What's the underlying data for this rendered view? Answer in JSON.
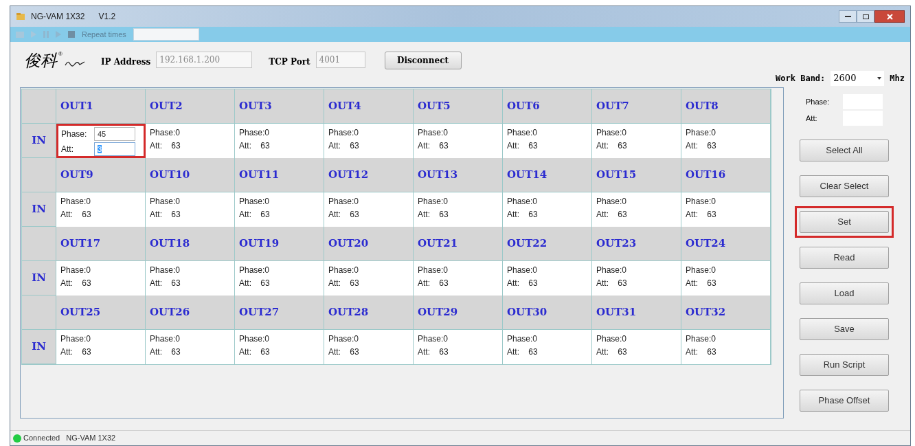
{
  "window": {
    "title": "NG-VAM 1X32",
    "version": "V1.2"
  },
  "toolbar": {
    "repeat_label": "Repeat times"
  },
  "logo": {
    "text": "俊科",
    "mark": "®"
  },
  "connection": {
    "ip_label": "IP Address",
    "ip_value": "192.168.1.200",
    "port_label": "TCP Port",
    "port_value": "4001",
    "button": "Disconnect"
  },
  "work_band": {
    "label": "Work Band:",
    "value": "2600",
    "unit": "Mhz"
  },
  "groups": [
    {
      "in_label": "IN",
      "outputs": [
        {
          "label": "OUT1",
          "kind": "input",
          "phase_label": "Phase:",
          "phase": "45",
          "att_label": "Att:",
          "att": "3",
          "att_selected": true,
          "highlighted": true
        },
        {
          "label": "OUT2",
          "kind": "text",
          "phase_label": "Phase:",
          "phase": "0",
          "att_label": "Att:",
          "att": "63",
          "highlighted": false
        },
        {
          "label": "OUT3",
          "kind": "text",
          "phase_label": "Phase:",
          "phase": "0",
          "att_label": "Att:",
          "att": "63",
          "highlighted": false
        },
        {
          "label": "OUT4",
          "kind": "text",
          "phase_label": "Phase:",
          "phase": "0",
          "att_label": "Att:",
          "att": "63",
          "highlighted": false
        },
        {
          "label": "OUT5",
          "kind": "text",
          "phase_label": "Phase:",
          "phase": "0",
          "att_label": "Att:",
          "att": "63",
          "highlighted": false
        },
        {
          "label": "OUT6",
          "kind": "text",
          "phase_label": "Phase:",
          "phase": "0",
          "att_label": "Att:",
          "att": "63",
          "highlighted": false
        },
        {
          "label": "OUT7",
          "kind": "text",
          "phase_label": "Phase:",
          "phase": "0",
          "att_label": "Att:",
          "att": "63",
          "highlighted": false
        },
        {
          "label": "OUT8",
          "kind": "text",
          "phase_label": "Phase:",
          "phase": "0",
          "att_label": "Att:",
          "att": "63",
          "highlighted": false
        }
      ]
    },
    {
      "in_label": "IN",
      "outputs": [
        {
          "label": "OUT9",
          "kind": "text",
          "phase_label": "Phase:",
          "phase": "0",
          "att_label": "Att:",
          "att": "63",
          "highlighted": false
        },
        {
          "label": "OUT10",
          "kind": "text",
          "phase_label": "Phase:",
          "phase": "0",
          "att_label": "Att:",
          "att": "63",
          "highlighted": false
        },
        {
          "label": "OUT11",
          "kind": "text",
          "phase_label": "Phase:",
          "phase": "0",
          "att_label": "Att:",
          "att": "63",
          "highlighted": false
        },
        {
          "label": "OUT12",
          "kind": "text",
          "phase_label": "Phase:",
          "phase": "0",
          "att_label": "Att:",
          "att": "63",
          "highlighted": false
        },
        {
          "label": "OUT13",
          "kind": "text",
          "phase_label": "Phase:",
          "phase": "0",
          "att_label": "Att:",
          "att": "63",
          "highlighted": false
        },
        {
          "label": "OUT14",
          "kind": "text",
          "phase_label": "Phase:",
          "phase": "0",
          "att_label": "Att:",
          "att": "63",
          "highlighted": false
        },
        {
          "label": "OUT15",
          "kind": "text",
          "phase_label": "Phase:",
          "phase": "0",
          "att_label": "Att:",
          "att": "63",
          "highlighted": false
        },
        {
          "label": "OUT16",
          "kind": "text",
          "phase_label": "Phase:",
          "phase": "0",
          "att_label": "Att:",
          "att": "63",
          "highlighted": false
        }
      ]
    },
    {
      "in_label": "IN",
      "outputs": [
        {
          "label": "OUT17",
          "kind": "text",
          "phase_label": "Phase:",
          "phase": "0",
          "att_label": "Att:",
          "att": "63",
          "highlighted": false
        },
        {
          "label": "OUT18",
          "kind": "text",
          "phase_label": "Phase:",
          "phase": "0",
          "att_label": "Att:",
          "att": "63",
          "highlighted": false
        },
        {
          "label": "OUT19",
          "kind": "text",
          "phase_label": "Phase:",
          "phase": "0",
          "att_label": "Att:",
          "att": "63",
          "highlighted": false
        },
        {
          "label": "OUT20",
          "kind": "text",
          "phase_label": "Phase:",
          "phase": "0",
          "att_label": "Att:",
          "att": "63",
          "highlighted": false
        },
        {
          "label": "OUT21",
          "kind": "text",
          "phase_label": "Phase:",
          "phase": "0",
          "att_label": "Att:",
          "att": "63",
          "highlighted": false
        },
        {
          "label": "OUT22",
          "kind": "text",
          "phase_label": "Phase:",
          "phase": "0",
          "att_label": "Att:",
          "att": "63",
          "highlighted": false
        },
        {
          "label": "OUT23",
          "kind": "text",
          "phase_label": "Phase:",
          "phase": "0",
          "att_label": "Att:",
          "att": "63",
          "highlighted": false
        },
        {
          "label": "OUT24",
          "kind": "text",
          "phase_label": "Phase:",
          "phase": "0",
          "att_label": "Att:",
          "att": "63",
          "highlighted": false
        }
      ]
    },
    {
      "in_label": "IN",
      "outputs": [
        {
          "label": "OUT25",
          "kind": "text",
          "phase_label": "Phase:",
          "phase": "0",
          "att_label": "Att:",
          "att": "63",
          "highlighted": false
        },
        {
          "label": "OUT26",
          "kind": "text",
          "phase_label": "Phase:",
          "phase": "0",
          "att_label": "Att:",
          "att": "63",
          "highlighted": false
        },
        {
          "label": "OUT27",
          "kind": "text",
          "phase_label": "Phase:",
          "phase": "0",
          "att_label": "Att:",
          "att": "63",
          "highlighted": false
        },
        {
          "label": "OUT28",
          "kind": "text",
          "phase_label": "Phase:",
          "phase": "0",
          "att_label": "Att:",
          "att": "63",
          "highlighted": false
        },
        {
          "label": "OUT29",
          "kind": "text",
          "phase_label": "Phase:",
          "phase": "0",
          "att_label": "Att:",
          "att": "63",
          "highlighted": false
        },
        {
          "label": "OUT30",
          "kind": "text",
          "phase_label": "Phase:",
          "phase": "0",
          "att_label": "Att:",
          "att": "63",
          "highlighted": false
        },
        {
          "label": "OUT31",
          "kind": "text",
          "phase_label": "Phase:",
          "phase": "0",
          "att_label": "Att:",
          "att": "63",
          "highlighted": false
        },
        {
          "label": "OUT32",
          "kind": "text",
          "phase_label": "Phase:",
          "phase": "0",
          "att_label": "Att:",
          "att": "63",
          "highlighted": false
        }
      ]
    }
  ],
  "side_panel": {
    "phase_label": "Phase:",
    "att_label": "Att:",
    "buttons": [
      {
        "label": "Select All",
        "highlighted": false
      },
      {
        "label": "Clear Select",
        "highlighted": false
      },
      {
        "label": "Set",
        "highlighted": true
      },
      {
        "label": "Read",
        "highlighted": false
      },
      {
        "label": "Load",
        "highlighted": false
      },
      {
        "label": "Save",
        "highlighted": false
      },
      {
        "label": "Run Script",
        "highlighted": false
      },
      {
        "label": "Phase Offset",
        "highlighted": false
      }
    ]
  },
  "status_bar": {
    "connected": true,
    "state": "Connected",
    "device": "NG-VAM 1X32"
  }
}
